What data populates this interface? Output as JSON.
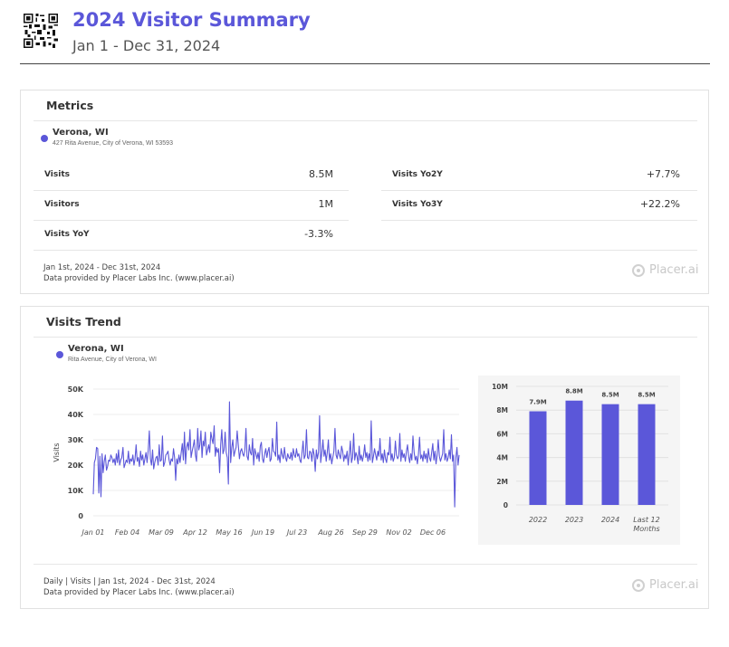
{
  "header": {
    "title": "2024 Visitor Summary",
    "date_range": "Jan 1 - Dec 31, 2024"
  },
  "metrics_card": {
    "title": "Metrics",
    "location": {
      "name": "Verona, WI",
      "address": "427 Rita Avenue, City of Verona, WI 53593"
    },
    "left_metrics": [
      {
        "label": "Visits",
        "value": "8.5M"
      },
      {
        "label": "Visitors",
        "value": "1M"
      },
      {
        "label": "Visits YoY",
        "value": "-3.3%"
      }
    ],
    "right_metrics": [
      {
        "label": "Visits Yo2Y",
        "value": "+7.7%"
      },
      {
        "label": "Visits Yo3Y",
        "value": "+22.2%"
      }
    ],
    "footer_line1": "Jan 1st, 2024 - Dec 31st, 2024",
    "footer_line2": "Data provided by Placer Labs Inc. (www.placer.ai)",
    "brand": "Placer.ai"
  },
  "trend_card": {
    "title": "Visits Trend",
    "location": {
      "name": "Verona, WI",
      "address": "Rita Avenue, City of Verona, WI"
    },
    "footer_line1": "Daily | Visits | Jan 1st, 2024 - Dec 31st, 2024",
    "footer_line2": "Data provided by Placer Labs Inc. (www.placer.ai)",
    "brand": "Placer.ai"
  },
  "colors": {
    "accent": "#5b57d9",
    "line": "#5b57d9",
    "bar": "#5b57d9"
  },
  "chart_data": [
    {
      "type": "line",
      "ylabel": "Visits",
      "ylim": [
        0,
        50000
      ],
      "y_ticks": [
        0,
        10000,
        20000,
        30000,
        40000,
        50000
      ],
      "y_tick_labels": [
        "0",
        "10K",
        "20K",
        "30K",
        "40K",
        "50K"
      ],
      "x_tick_labels": [
        "Jan 01",
        "Feb 04",
        "Mar 09",
        "Apr 12",
        "May 16",
        "Jun 19",
        "Jul 23",
        "Aug 26",
        "Sep 29",
        "Nov 02",
        "Dec 06"
      ],
      "x_range": [
        "2024-01-01",
        "2024-12-31"
      ],
      "grid": true,
      "series": [
        {
          "values": [
            8500,
            21000,
            22500,
            27000,
            26500,
            9000,
            23500,
            7500,
            24500,
            17000,
            21500,
            24000,
            18000,
            19500,
            22000,
            21500,
            24000,
            23000,
            21000,
            22500,
            20000,
            24500,
            21000,
            26000,
            20000,
            22000,
            23000,
            27000,
            19000,
            20500,
            22000,
            21000,
            25500,
            20500,
            22500,
            21500,
            24000,
            20000,
            22500,
            28000,
            21500,
            23000,
            19500,
            25500,
            22000,
            24000,
            20000,
            22500,
            25000,
            21000,
            26000,
            33500,
            22500,
            20000,
            26000,
            18500,
            21000,
            23000,
            23500,
            20000,
            28000,
            21500,
            22000,
            31500,
            19500,
            21000,
            24000,
            24500,
            25500,
            22000,
            20000,
            22500,
            21500,
            26500,
            23000,
            14000,
            22500,
            20500,
            24000,
            21000,
            25000,
            28500,
            22000,
            33000,
            20500,
            27000,
            29000,
            26000,
            34000,
            23000,
            25500,
            27500,
            30000,
            24000,
            21500,
            34500,
            26000,
            28000,
            33500,
            23000,
            29500,
            27500,
            33000,
            24000,
            26000,
            28000,
            25000,
            33000,
            30500,
            28500,
            35500,
            23500,
            27000,
            25000,
            26500,
            17000,
            28000,
            34000,
            24500,
            26000,
            33000,
            25000,
            23000,
            12500,
            45000,
            21000,
            27000,
            30000,
            23500,
            25500,
            27000,
            33500,
            28000,
            22500,
            25500,
            26500,
            24500,
            23500,
            26000,
            34500,
            23500,
            22000,
            28000,
            25000,
            24000,
            30500,
            20000,
            26500,
            24500,
            22500,
            25000,
            21500,
            27500,
            29000,
            22500,
            21000,
            24500,
            26500,
            23000,
            25500,
            27000,
            21500,
            22500,
            30500,
            25500,
            25000,
            23500,
            37000,
            22000,
            24000,
            21000,
            26500,
            24000,
            22500,
            27000,
            23000,
            21500,
            24500,
            23000,
            22500,
            25000,
            22000,
            26500,
            24000,
            23000,
            26500,
            23500,
            24500,
            22000,
            21000,
            25000,
            29500,
            22500,
            24000,
            34000,
            23000,
            22500,
            25500,
            25000,
            21500,
            26500,
            24000,
            17500,
            26000,
            22500,
            25000,
            39500,
            21000,
            24500,
            30000,
            23500,
            26000,
            21500,
            25000,
            30000,
            22000,
            24500,
            20500,
            23000,
            25500,
            34500,
            24000,
            22500,
            26000,
            24000,
            22500,
            27500,
            25500,
            21500,
            24000,
            22500,
            25500,
            20000,
            24500,
            29500,
            21000,
            23000,
            32500,
            22000,
            25000,
            23500,
            20500,
            27500,
            22000,
            24000,
            21500,
            24000,
            28000,
            23000,
            25000,
            21500,
            24500,
            22000,
            37500,
            21000,
            23500,
            26500,
            24000,
            22000,
            25500,
            23500,
            30500,
            22000,
            24500,
            21000,
            26000,
            22500,
            21000,
            25000,
            24000,
            31000,
            22000,
            24500,
            21500,
            23000,
            29500,
            24000,
            22500,
            23500,
            32500,
            21500,
            26000,
            23000,
            24500,
            21500,
            25500,
            28000,
            23500,
            21000,
            24500,
            22000,
            31500,
            25000,
            22000,
            23500,
            20500,
            24500,
            31000,
            22500,
            24000,
            21500,
            25500,
            22500,
            24500,
            21000,
            26500,
            23000,
            21500,
            25000,
            28500,
            22000,
            25500,
            20500,
            24000,
            30000,
            23500,
            21500,
            23000,
            24500,
            34000,
            22000,
            24500,
            21500,
            23000,
            26000,
            22500,
            32000,
            21500,
            24000,
            3500,
            23000,
            27000,
            20000,
            24000
          ],
          "note": "daily visits 2024"
        }
      ]
    },
    {
      "type": "bar",
      "categories": [
        "2022",
        "2023",
        "2024",
        "Last 12 Months"
      ],
      "values": [
        7.9,
        8.8,
        8.5,
        8.5
      ],
      "value_labels": [
        "7.9M",
        "8.8M",
        "8.5M",
        "8.5M"
      ],
      "ylim": [
        0,
        10
      ],
      "y_tick_labels": [
        "0",
        "2M",
        "4M",
        "6M",
        "8M",
        "10M"
      ],
      "grid": true
    }
  ]
}
